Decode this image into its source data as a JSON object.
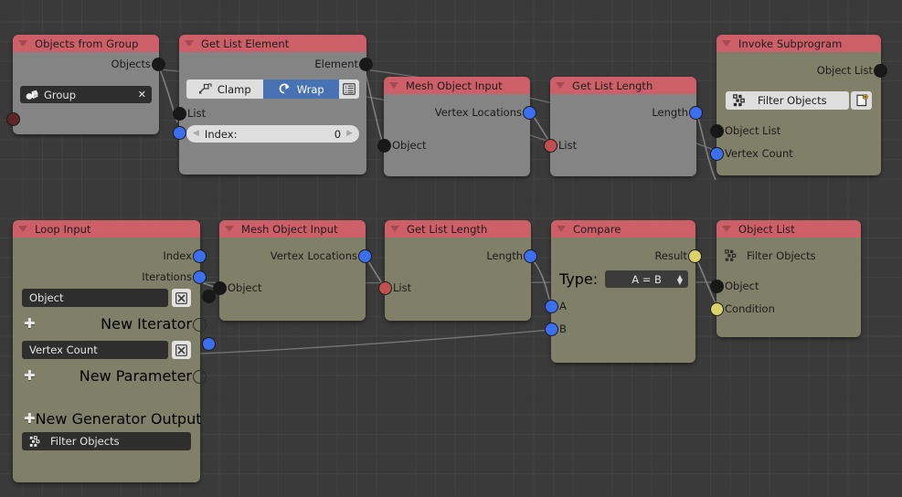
{
  "app": {
    "editor": "blender-node-editor",
    "background_color": "#3a3a3a"
  },
  "colors": {
    "header_red": "#cc5f68",
    "body_gray": "#848484",
    "body_olive": "#807f67",
    "socket_object": "#181818",
    "socket_number": "#3b6ef0",
    "socket_list": "#c05050",
    "socket_boolean": "#dbd167",
    "socket_group": "#5c2626",
    "toggle_active": "#4772b3"
  },
  "nodes": {
    "objects_from_group": {
      "title": "Objects from Group",
      "outputs": [
        {
          "label": "Objects",
          "type": "object"
        }
      ],
      "group_field": {
        "value": "Group",
        "icon": "group-objects-icon",
        "clear": "✕"
      }
    },
    "get_list_element": {
      "title": "Get List Element",
      "outputs": [
        {
          "label": "Element",
          "type": "object"
        }
      ],
      "mode": {
        "clamp_label": "Clamp",
        "wrap_label": "Wrap",
        "selected": "Wrap",
        "extra_icon": "list-ordered-icon"
      },
      "inputs": [
        {
          "label": "List",
          "type": "object"
        }
      ],
      "index_field": {
        "label": "Index:",
        "value": "0"
      }
    },
    "mesh_object_input_top": {
      "title": "Mesh Object Input",
      "outputs": [
        {
          "label": "Vertex Locations",
          "type": "number"
        }
      ],
      "inputs": [
        {
          "label": "Object",
          "type": "object"
        }
      ]
    },
    "get_list_length_top": {
      "title": "Get List Length",
      "outputs": [
        {
          "label": "Length",
          "type": "number"
        }
      ],
      "inputs": [
        {
          "label": "List",
          "type": "list"
        }
      ]
    },
    "invoke_subprogram": {
      "title": "Invoke Subprogram",
      "outputs": [
        {
          "label": "Object List",
          "type": "object"
        }
      ],
      "subprogram_field": {
        "value": "Filter Objects",
        "icon": "nodes-icon",
        "action_icon": "new-file-icon"
      },
      "inputs": [
        {
          "label": "Object List",
          "type": "object"
        },
        {
          "label": "Vertex Count",
          "type": "number"
        }
      ]
    },
    "loop_input": {
      "title": "Loop Input",
      "outputs": [
        {
          "label": "Index",
          "type": "number"
        },
        {
          "label": "Iterations",
          "type": "number"
        }
      ],
      "iterator_field": {
        "value": "Object",
        "remove_icon": "x-box-icon"
      },
      "new_iterator": {
        "label": "New Iterator",
        "plus": "➕"
      },
      "parameter_field": {
        "value": "Vertex Count",
        "remove_icon": "x-box-icon"
      },
      "new_parameter": {
        "label": "New Parameter",
        "plus": "➕"
      },
      "new_generator_output": {
        "label": "New Generator Output",
        "plus": "➕"
      },
      "subprogram_field": {
        "value": "Filter Objects",
        "icon": "nodes-dotted-icon"
      }
    },
    "mesh_object_input_bottom": {
      "title": "Mesh Object Input",
      "outputs": [
        {
          "label": "Vertex Locations",
          "type": "number"
        }
      ],
      "inputs": [
        {
          "label": "Object",
          "type": "object"
        }
      ]
    },
    "get_list_length_bottom": {
      "title": "Get List Length",
      "outputs": [
        {
          "label": "Length",
          "type": "number"
        }
      ],
      "inputs": [
        {
          "label": "List",
          "type": "list"
        }
      ]
    },
    "compare": {
      "title": "Compare",
      "outputs": [
        {
          "label": "Result",
          "type": "boolean"
        }
      ],
      "type_row": {
        "label": "Type:",
        "value": "A = B"
      },
      "inputs": [
        {
          "label": "A",
          "type": "number"
        },
        {
          "label": "B",
          "type": "number"
        }
      ]
    },
    "object_list_output": {
      "title": "Object List",
      "subprogram_field": {
        "value": "Filter Objects",
        "icon": "nodes-icon"
      },
      "inputs": [
        {
          "label": "Object",
          "type": "object"
        },
        {
          "label": "Condition",
          "type": "boolean"
        }
      ]
    }
  }
}
